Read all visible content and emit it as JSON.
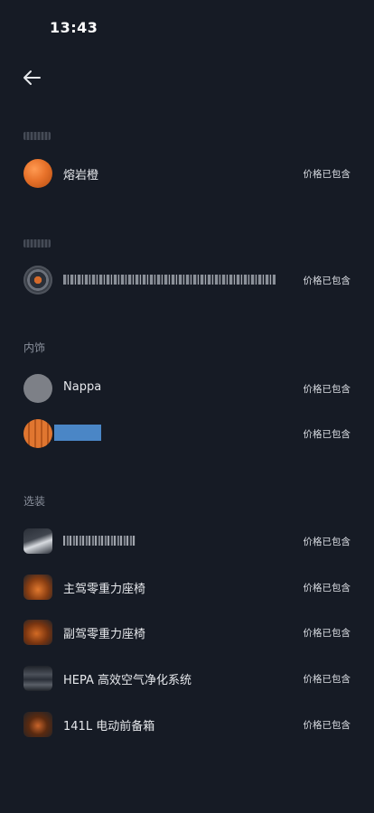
{
  "status_bar": {
    "time": "13:43"
  },
  "sections": {
    "exterior_color_row": {
      "label": "熔岩橙",
      "price": "价格已包含",
      "swatch_color": "#e8722a"
    },
    "wheel_row": {
      "price": "价格已包含"
    },
    "interior": {
      "header": "内饰",
      "rows": [
        {
          "label": "Nappa",
          "price": "价格已包含",
          "swatch_color": "#7d8087"
        },
        {
          "price": "价格已包含",
          "swatch_color": "#e07630"
        }
      ]
    },
    "options": {
      "header": "选装",
      "rows": [
        {
          "price": "价格已包含"
        },
        {
          "label": "主驾零重力座椅",
          "price": "价格已包含"
        },
        {
          "label": "副驾零重力座椅",
          "price": "价格已包含"
        },
        {
          "label": "HEPA 高效空气净化系统",
          "price": "价格已包含"
        },
        {
          "label": "141L 电动前备箱",
          "price": "价格已包含"
        }
      ]
    }
  },
  "icons": {
    "back": "arrow-left-icon"
  }
}
